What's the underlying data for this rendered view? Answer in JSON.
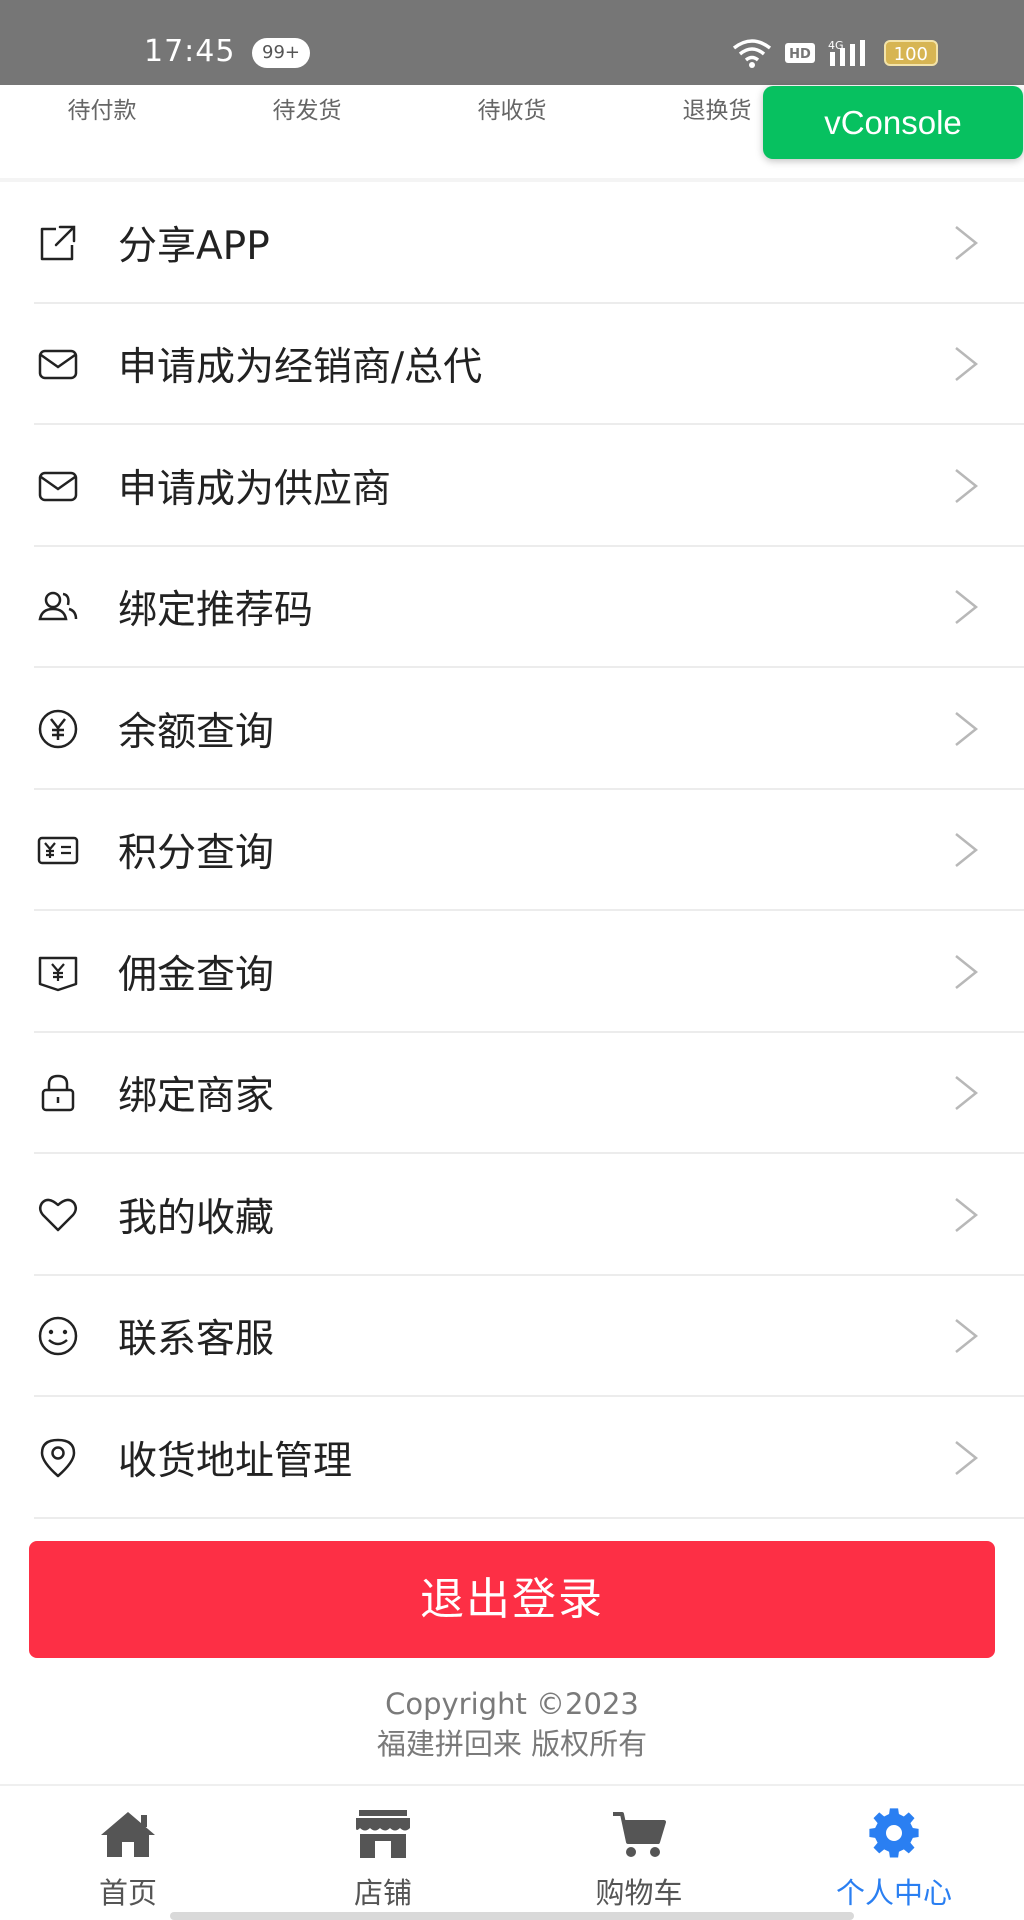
{
  "status_bar": {
    "time": "17:45",
    "notification_badge": "99+",
    "battery": "100"
  },
  "order_tabs": [
    "待付款",
    "待发货",
    "待收货",
    "退换货"
  ],
  "vconsole_label": "vConsole",
  "menu": [
    {
      "label": "分享APP",
      "icon": "share-icon"
    },
    {
      "label": "申请成为经销商/总代",
      "icon": "mail-icon"
    },
    {
      "label": "申请成为供应商",
      "icon": "mail-icon"
    },
    {
      "label": "绑定推荐码",
      "icon": "users-icon"
    },
    {
      "label": "余额查询",
      "icon": "yen-circle-icon"
    },
    {
      "label": "积分查询",
      "icon": "points-ticket-icon"
    },
    {
      "label": "佣金查询",
      "icon": "commission-yen-icon"
    },
    {
      "label": "绑定商家",
      "icon": "lock-icon"
    },
    {
      "label": "我的收藏",
      "icon": "heart-icon"
    },
    {
      "label": "联系客服",
      "icon": "smile-icon"
    },
    {
      "label": "收货地址管理",
      "icon": "location-icon"
    }
  ],
  "logout_label": "退出登录",
  "copyright": {
    "line1": "Copyright ©2023",
    "line2": "福建拼回来 版权所有"
  },
  "tab_bar": [
    {
      "label": "首页",
      "icon": "home-icon",
      "active": false
    },
    {
      "label": "店铺",
      "icon": "store-icon",
      "active": false
    },
    {
      "label": "购物车",
      "icon": "cart-icon",
      "active": false
    },
    {
      "label": "个人中心",
      "icon": "gear-icon",
      "active": true
    }
  ],
  "colors": {
    "status_bar": "#767676",
    "vconsole": "#07c160",
    "logout_button": "#fd2f45",
    "active_tab": "#2a7ff2"
  }
}
